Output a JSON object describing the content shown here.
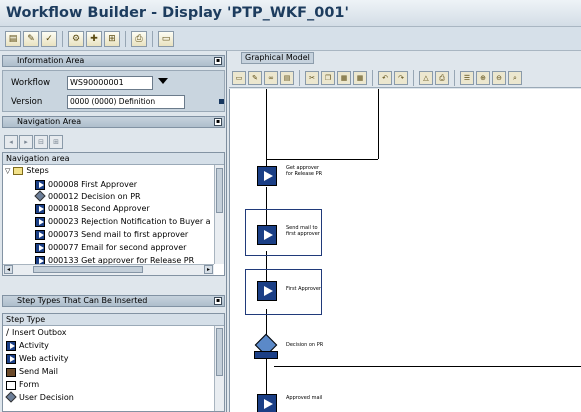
{
  "window": {
    "title": "Workflow Builder - Display 'PTP_WKF_001'"
  },
  "info_area": {
    "title": "Information Area",
    "workflow_label": "Workflow",
    "workflow_value": "WS90000001",
    "version_label": "Version",
    "version_value": "0000 (0000) Definition"
  },
  "navigation": {
    "title": "Navigation Area",
    "column_header": "Navigation area",
    "root": "Steps",
    "items": [
      {
        "label": "000008 First Approver",
        "icon": "activity-step-icon"
      },
      {
        "label": "000012 Decision on PR",
        "icon": "decision-step-icon"
      },
      {
        "label": "000018 Second Approver",
        "icon": "activity-step-icon"
      },
      {
        "label": "000023 Rejection Notification to Buyer a",
        "icon": "activity-step-icon"
      },
      {
        "label": "000073 Send mail to first approver",
        "icon": "activity-step-icon"
      },
      {
        "label": "000077 Email for second approver",
        "icon": "activity-step-icon"
      },
      {
        "label": "000133 Get approver for Release  PR",
        "icon": "activity-step-icon"
      }
    ]
  },
  "step_types": {
    "title": "Step Types That Can Be Inserted",
    "column_header": "Step Type",
    "items": [
      {
        "label": "Insert Outbox"
      },
      {
        "label": "Activity"
      },
      {
        "label": "Web activity"
      },
      {
        "label": "Send Mail"
      },
      {
        "label": "Form"
      },
      {
        "label": "User Decision"
      }
    ]
  },
  "graph": {
    "title": "Graphical Model",
    "nodes": [
      {
        "label": "Get approver for Release PR"
      },
      {
        "label": "Send mail to first approver"
      },
      {
        "label": "First Approver"
      },
      {
        "label": "Decision on PR"
      },
      {
        "label": "Approved mail"
      }
    ]
  },
  "colors": {
    "step_blue": "#1b3f86",
    "title_text": "#1d3c5e",
    "panel_bg": "#dfe6ec"
  }
}
